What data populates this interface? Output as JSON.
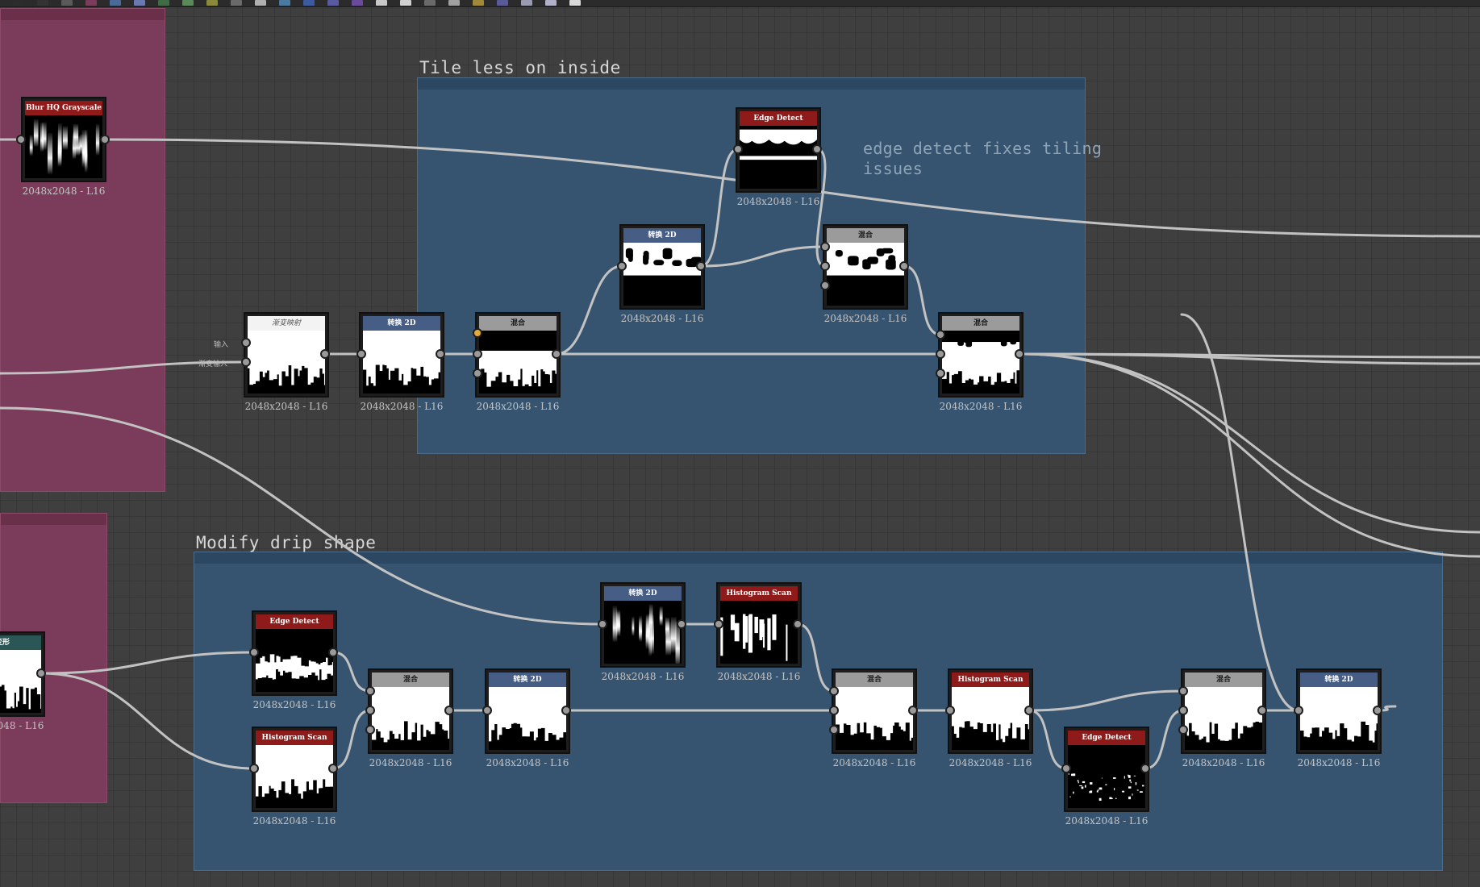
{
  "toolbar": {
    "icons": [
      "layout-icon",
      "frame-icon",
      "comment-icon",
      "pin-icon",
      "node-icon",
      "graph-icon",
      "image-icon",
      "function-icon",
      "output-icon",
      "input-icon",
      "color-icon",
      "grayscale-icon",
      "gradient-icon",
      "curve-icon",
      "layers-icon",
      "bitmap-icon",
      "blend-icon",
      "transform-icon",
      "filter-icon",
      "noise-icon",
      "pattern-icon",
      "view-icon",
      "grid-icon",
      "snap-icon"
    ],
    "colors": [
      "#2c2c2c",
      "#333333",
      "#5a5a5a",
      "#7a3c5a",
      "#4a6a9a",
      "#6a7ab0",
      "#3d6c45",
      "#5a8a5a",
      "#8a8a3a",
      "#6a6a6a",
      "#b0b0b0",
      "#4a7aa0",
      "#3d5aa0",
      "#5a5aa0",
      "#6a4a9a",
      "#c8c8c8",
      "#d0d0d0",
      "#6a6a6a",
      "#a0a0a0",
      "#a08a3a",
      "#5a5a9a",
      "#9a9ab0",
      "#b0b0c8",
      "#d8d8d8"
    ]
  },
  "frames": [
    {
      "name": "pink-frame-top",
      "title": ""
    },
    {
      "name": "pink-frame-bottom",
      "title": ""
    },
    {
      "name": "frame-tile-less",
      "title": "Tile less on inside"
    },
    {
      "name": "frame-modify-drip",
      "title": "Modify drip shape"
    }
  ],
  "comment": {
    "text": "edge detect fixes tiling\nissues"
  },
  "resolution_label": "2048x2048 - L16",
  "nodes": [
    {
      "id": "n1",
      "title": "Blur HQ Grayscale",
      "header": "red",
      "thumb": "streaks"
    },
    {
      "id": "n2",
      "title": "渐变映射",
      "header": "none",
      "thumb": "city"
    },
    {
      "id": "n3",
      "title": "转换 2D",
      "header": "blue",
      "thumb": "city"
    },
    {
      "id": "n4",
      "title": "混合",
      "header": "grey",
      "thumb": "blackcity"
    },
    {
      "id": "n5",
      "title": "转换 2D",
      "header": "blue",
      "thumb": "drips"
    },
    {
      "id": "n6",
      "title": "Edge Detect",
      "header": "red",
      "thumb": "edgeline"
    },
    {
      "id": "n7",
      "title": "混合",
      "header": "grey",
      "thumb": "drips"
    },
    {
      "id": "n8",
      "title": "混合",
      "header": "grey",
      "thumb": "dripcity"
    },
    {
      "id": "n9",
      "title": "变形",
      "header": "teal",
      "thumb": "sidemask"
    },
    {
      "id": "n10",
      "title": "Edge Detect",
      "header": "red",
      "thumb": "edgecity"
    },
    {
      "id": "n11",
      "title": "Histogram Scan",
      "header": "red",
      "thumb": "city"
    },
    {
      "id": "n12",
      "title": "混合",
      "header": "grey",
      "thumb": "city"
    },
    {
      "id": "n13",
      "title": "转换 2D",
      "header": "blue",
      "thumb": "city"
    },
    {
      "id": "n14",
      "title": "转换 2D",
      "header": "blue",
      "thumb": "streaks"
    },
    {
      "id": "n15",
      "title": "Histogram Scan",
      "header": "red",
      "thumb": "whitestreaks"
    },
    {
      "id": "n16",
      "title": "混合",
      "header": "grey",
      "thumb": "city"
    },
    {
      "id": "n17",
      "title": "Histogram Scan",
      "header": "red",
      "thumb": "city"
    },
    {
      "id": "n18",
      "title": "Edge Detect",
      "header": "red",
      "thumb": "dots"
    },
    {
      "id": "n19",
      "title": "混合",
      "header": "grey",
      "thumb": "city"
    },
    {
      "id": "n20",
      "title": "转换 2D",
      "header": "blue",
      "thumb": "city"
    }
  ],
  "port_labels": {
    "input": "输入",
    "second": "渐变输入"
  },
  "wire_color": "#c2c2c2"
}
